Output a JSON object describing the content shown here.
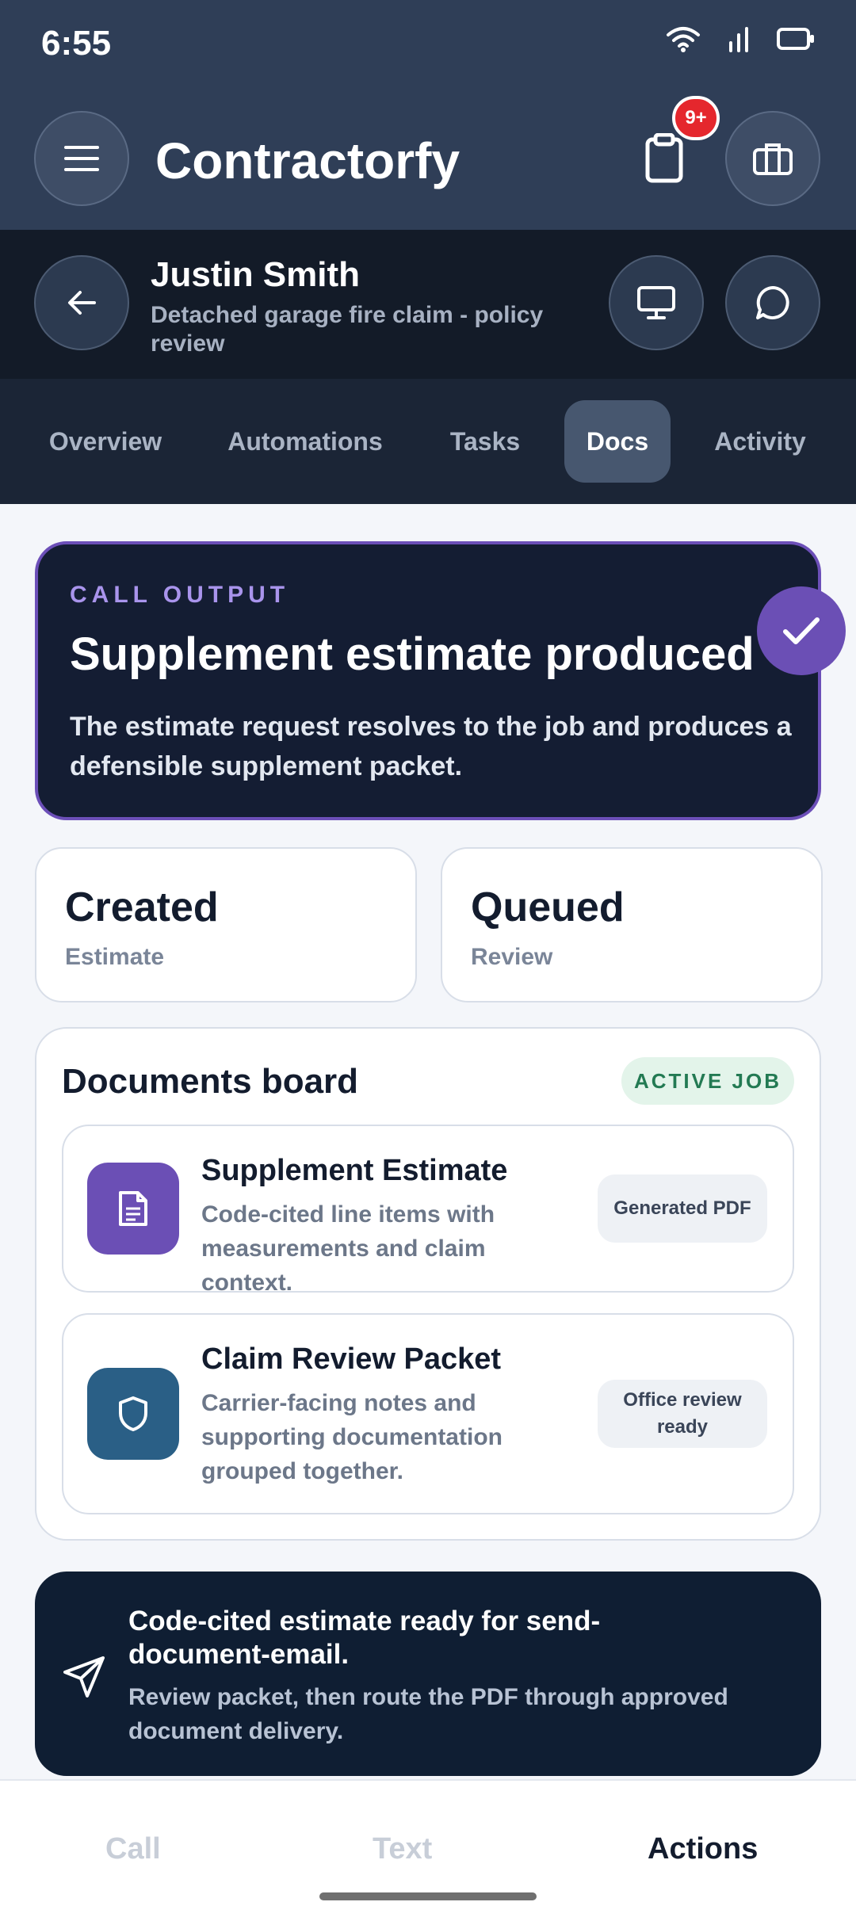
{
  "status_bar": {
    "time": "6:55"
  },
  "header": {
    "app_title": "Contractorfy",
    "notification_badge": "9+"
  },
  "job": {
    "name": "Justin Smith",
    "subtitle": "Detached garage fire claim - policy review"
  },
  "tabs": [
    {
      "label": "Overview"
    },
    {
      "label": "Automations"
    },
    {
      "label": "Tasks"
    },
    {
      "label": "Docs",
      "active": true
    },
    {
      "label": "Activity"
    }
  ],
  "hero": {
    "eyebrow": "CALL OUTPUT",
    "title": "Supplement estimate produced",
    "description": "The estimate request resolves to the job and produces a defensible supplement packet."
  },
  "stats": [
    {
      "value": "Created",
      "label": "Estimate"
    },
    {
      "value": "Queued",
      "label": "Review"
    }
  ],
  "board": {
    "title": "Documents board",
    "status_pill": "ACTIVE JOB",
    "docs": [
      {
        "title": "Supplement Estimate",
        "description": "Code-cited line items with measurements and claim context.",
        "status": "Generated PDF",
        "icon": "document-icon",
        "color": "#6b4fb5"
      },
      {
        "title": "Claim Review Packet",
        "description": "Carrier-facing notes and supporting documentation grouped together.",
        "status": "Office review ready",
        "icon": "shield-icon",
        "color": "#2a5f86"
      }
    ]
  },
  "banner": {
    "title": "Code-cited estimate ready for send-document-email.",
    "description": "Review packet, then route the PDF through approved document delivery.",
    "icon": "send-icon"
  },
  "bottom_nav": [
    {
      "label": "Call"
    },
    {
      "label": "Text"
    },
    {
      "label": "Actions",
      "active": true
    }
  ],
  "colors": {
    "header": "#2f3e57",
    "accent": "#6b4fb5",
    "badge": "#e5272d",
    "success": "#237a53"
  }
}
